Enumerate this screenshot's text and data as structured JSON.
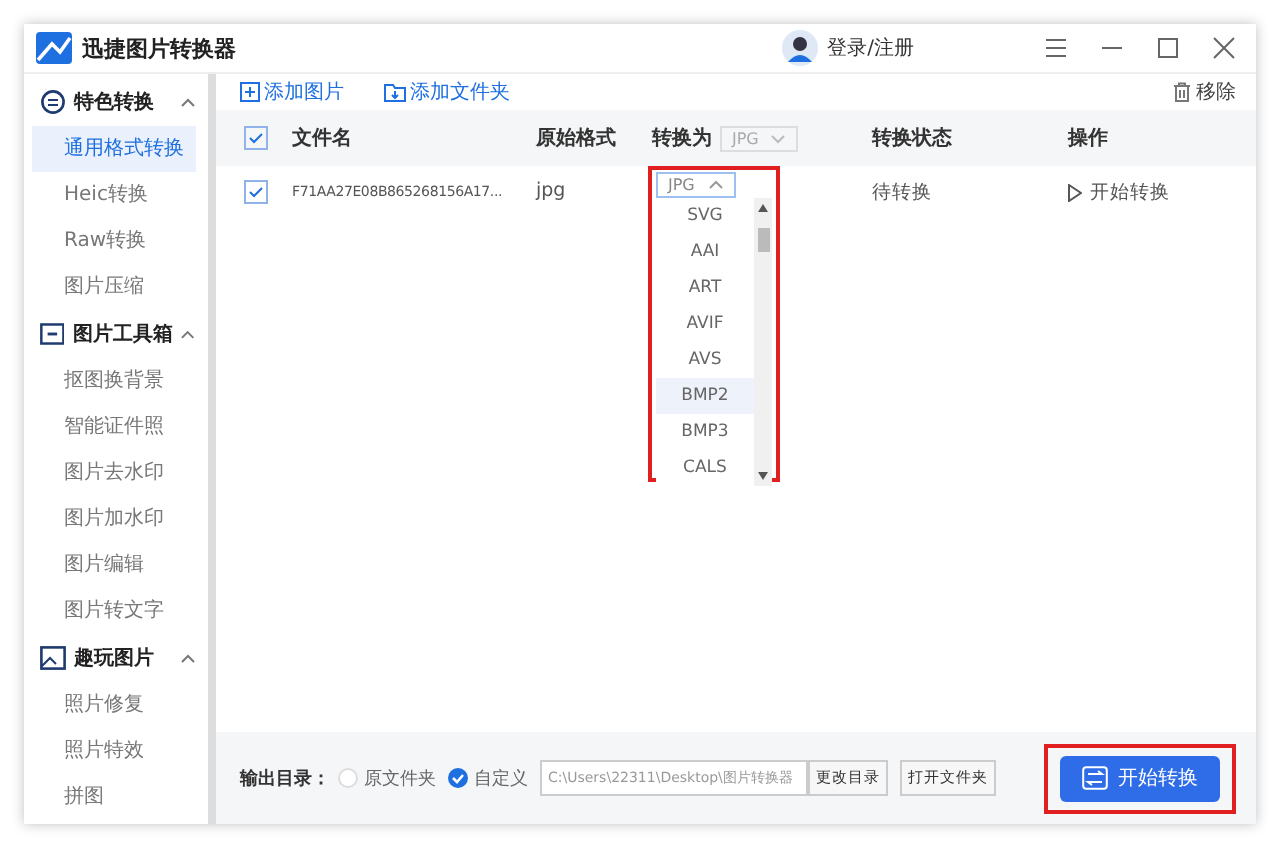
{
  "window": {
    "title": "迅捷图片转换器",
    "account": "登录/注册"
  },
  "toolbar": {
    "add_image": "添加图片",
    "add_folder": "添加文件夹",
    "remove": "移除"
  },
  "sidebar": {
    "groups": [
      {
        "label": "特色转换",
        "expanded": true,
        "items": [
          {
            "label": "通用格式转换",
            "selected": true
          },
          {
            "label": "Heic转换",
            "selected": false
          },
          {
            "label": "Raw转换",
            "selected": false
          },
          {
            "label": "图片压缩",
            "selected": false
          }
        ]
      },
      {
        "label": "图片工具箱",
        "expanded": true,
        "items": [
          {
            "label": "抠图换背景",
            "selected": false
          },
          {
            "label": "智能证件照",
            "selected": false
          },
          {
            "label": "图片去水印",
            "selected": false
          },
          {
            "label": "图片加水印",
            "selected": false
          },
          {
            "label": "图片编辑",
            "selected": false
          },
          {
            "label": "图片转文字",
            "selected": false
          }
        ]
      },
      {
        "label": "趣玩图片",
        "expanded": true,
        "items": [
          {
            "label": "照片修复",
            "selected": false
          },
          {
            "label": "照片特效",
            "selected": false
          },
          {
            "label": "拼图",
            "selected": false
          }
        ]
      }
    ]
  },
  "table": {
    "all_checked": true,
    "columns": [
      "文件名",
      "原始格式",
      "转换为",
      "转换状态",
      "操作"
    ],
    "target_all": "JPG",
    "rows": [
      {
        "checked": true,
        "filename": "F71AA27E08B865268156A17...",
        "format": "jpg",
        "target": "JPG",
        "status": "待转换",
        "action": "开始转换"
      }
    ]
  },
  "dropdown": {
    "options": [
      {
        "label": "SVG",
        "highlighted": false
      },
      {
        "label": "AAI",
        "highlighted": false
      },
      {
        "label": "ART",
        "highlighted": false
      },
      {
        "label": "AVIF",
        "highlighted": false
      },
      {
        "label": "AVS",
        "highlighted": false
      },
      {
        "label": "BMP2",
        "highlighted": true
      },
      {
        "label": "BMP3",
        "highlighted": false
      },
      {
        "label": "CALS",
        "highlighted": false
      }
    ]
  },
  "footer": {
    "output_label": "输出目录：",
    "destinations": [
      {
        "label": "原文件夹",
        "selected": false
      },
      {
        "label": "自定义",
        "selected": true
      }
    ],
    "path": "C:\\Users\\22311\\Desktop\\图片转换器",
    "change_dir": "更改目录",
    "open_folder": "打开文件夹",
    "start": "开始转换"
  }
}
